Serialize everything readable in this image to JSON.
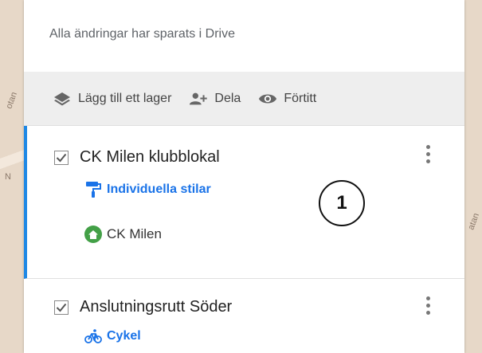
{
  "status_text": "Alla ändringar har sparats i Drive",
  "toolbar": {
    "add_layer": "Lägg till ett lager",
    "share": "Dela",
    "preview": "Förtitt"
  },
  "layers": [
    {
      "title": "CK Milen klubblokal",
      "style_label": "Individuella stilar",
      "items": [
        {
          "label": "CK Milen",
          "icon": "home-icon"
        }
      ]
    },
    {
      "title": "Anslutningsrutt Söder",
      "style_label": "Cykel"
    }
  ],
  "callout": "1",
  "colors": {
    "accent": "#1e88e5",
    "link": "#1a73e8",
    "home_icon": "#43a047"
  }
}
